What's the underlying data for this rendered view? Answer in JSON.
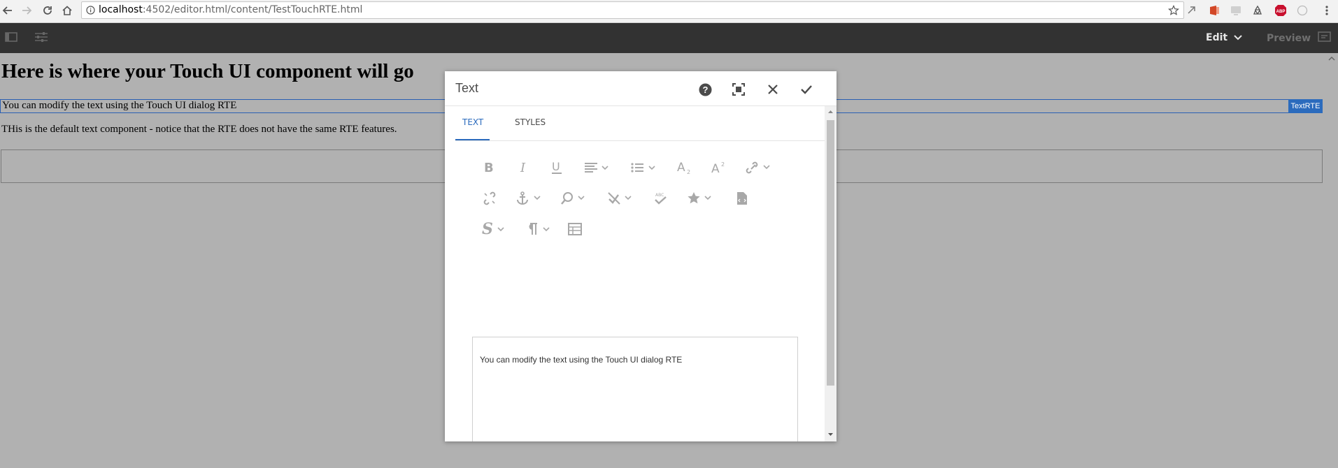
{
  "browser": {
    "url_host": "localhost",
    "url_rest": ":4502/editor.html/content/TestTouchRTE.html"
  },
  "toolbar": {
    "edit_label": "Edit",
    "preview_label": "Preview"
  },
  "page": {
    "title": "Here is where your Touch UI component will go",
    "rte_text": "You can modify the text using the Touch UI dialog RTE",
    "rte_badge": "TextRTE",
    "default_text": "THis is the default text component - notice that the RTE does not have the same RTE features."
  },
  "dialog": {
    "title": "Text",
    "tabs": [
      {
        "label": "TEXT",
        "active": true
      },
      {
        "label": "STYLES",
        "active": false
      }
    ],
    "toolbar_icons": [
      "bold-icon",
      "italic-icon",
      "underline-icon",
      "justify-icon",
      "list-icon",
      "subscript-icon",
      "superscript-icon",
      "link-icon",
      "unlink-icon",
      "anchor-icon",
      "find-replace-icon",
      "spellcheck-off-icon",
      "spellcheck-icon",
      "special-chars-icon",
      "source-edit-icon",
      "styles-icon",
      "paraformat-icon",
      "table-icon"
    ],
    "editor_text": "You can modify the text using the Touch UI dialog RTE"
  },
  "colors": {
    "accent": "#2b6bbd",
    "toolbar_bg": "#323232",
    "overlay_bg": "#b1b1b1"
  }
}
